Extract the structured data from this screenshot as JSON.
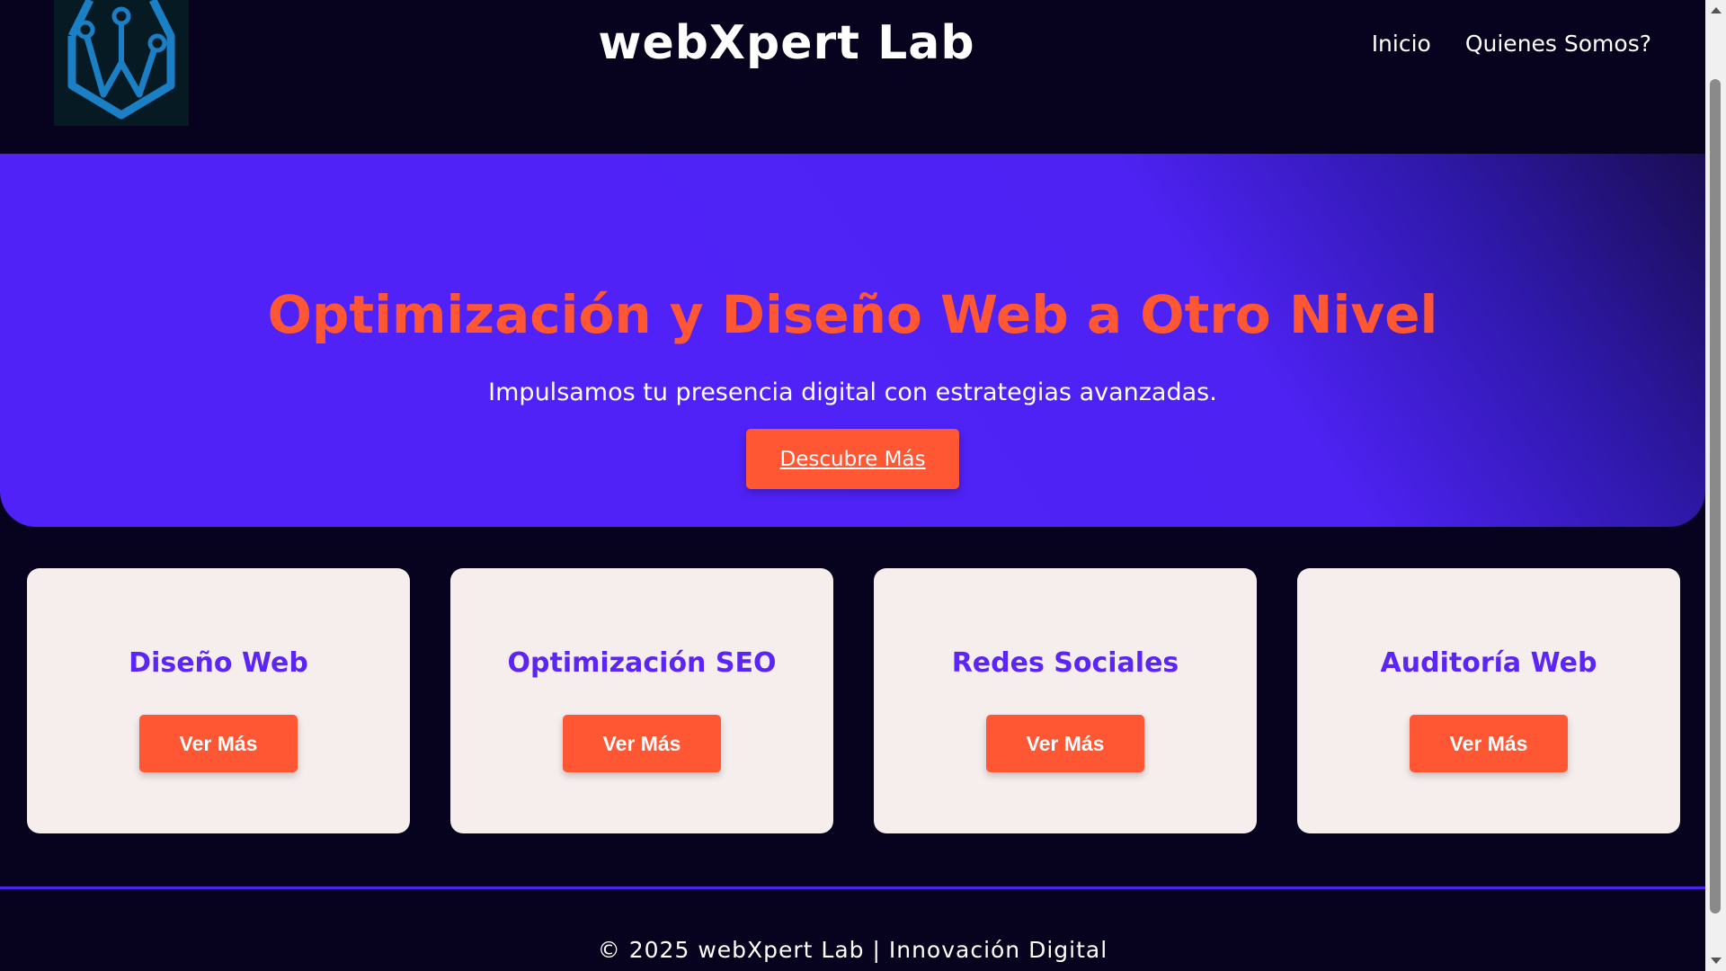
{
  "header": {
    "site_title": "webXpert Lab",
    "logo_icon": "circuit-crown-hexagon-icon",
    "nav": [
      {
        "label": "Inicio"
      },
      {
        "label": "Quienes Somos?"
      }
    ]
  },
  "hero": {
    "title": "Optimización y Diseño Web a Otro Nivel",
    "subtitle": "Impulsamos tu presencia digital con estrategias avanzadas.",
    "cta_label": "Descubre Más"
  },
  "cards": [
    {
      "title": "Diseño Web",
      "button_label": "Ver Más"
    },
    {
      "title": "Optimización SEO",
      "button_label": "Ver Más"
    },
    {
      "title": "Redes Sociales",
      "button_label": "Ver Más"
    },
    {
      "title": "Auditoría Web",
      "button_label": "Ver Más"
    }
  ],
  "footer": {
    "text": "© 2025 webXpert Lab | Innovación Digital"
  },
  "colors": {
    "background": "#07031f",
    "accent": "#ff5733",
    "primary": "#5022f8",
    "card_bg": "#f6eded",
    "logo_blue": "#1a7fc4"
  }
}
